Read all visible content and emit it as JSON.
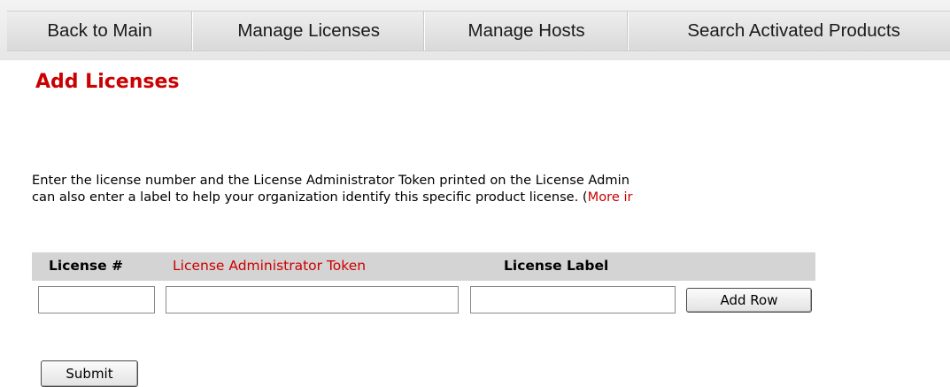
{
  "nav": {
    "tabs": [
      {
        "label": "Back to Main"
      },
      {
        "label": "Manage Licenses"
      },
      {
        "label": "Manage Hosts"
      },
      {
        "label": "Search Activated Products"
      }
    ]
  },
  "page": {
    "title": "Add Licenses"
  },
  "instructions": {
    "line1": "Enter the license number and the License Administrator Token printed on the License Admin",
    "line2_prefix": "can also enter a label to help your organization identify this specific product license. (",
    "more_info_link": "More ir"
  },
  "license_table": {
    "headers": {
      "license_number": "License #",
      "admin_token": "License Administrator Token",
      "license_label": "License Label"
    },
    "row": {
      "license_number": "",
      "admin_token": "",
      "license_label": ""
    },
    "add_row_label": "Add Row"
  },
  "form": {
    "submit_label": "Submit"
  },
  "colors": {
    "accent_red": "#cc0000",
    "header_gray": "#d4d4d4"
  }
}
